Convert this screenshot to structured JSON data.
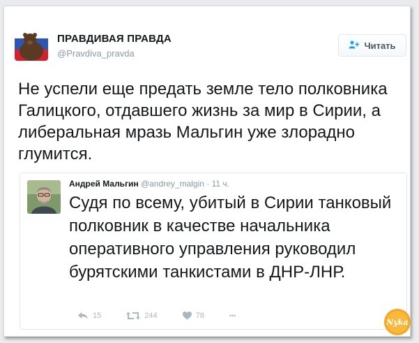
{
  "author": {
    "name": "ПРАВДИВАЯ ПРАВДА",
    "handle": "@Pravdiva_pravda"
  },
  "follow_button": {
    "label": "Читать",
    "icon": "add-user-icon"
  },
  "tweet": {
    "text": "Не успели еще предать земле тело полковника Галицкого, отдавшего жизнь за мир в Сирии, а либеральная мразь Мальгин уже злорадно глумится."
  },
  "quoted_tweet": {
    "author_name": "Андрей Мальгин",
    "handle": "@andrey_malgin",
    "separator": "·",
    "time": "11 ч.",
    "text": "Судя по всему, убитый в Сирии танковый полковник в качестве начальника оперативного управления руководил бурятскими танкистами в ДНР-ЛНР."
  },
  "actions": {
    "reply_count": "15",
    "retweet_count": "244",
    "like_count": "78",
    "more_label": "•••"
  },
  "watermark": {
    "text": "Nyka"
  },
  "colors": {
    "accent": "#1da1f2",
    "text": "#14171a",
    "muted": "#8899a6",
    "action": "#a8b7c2"
  }
}
